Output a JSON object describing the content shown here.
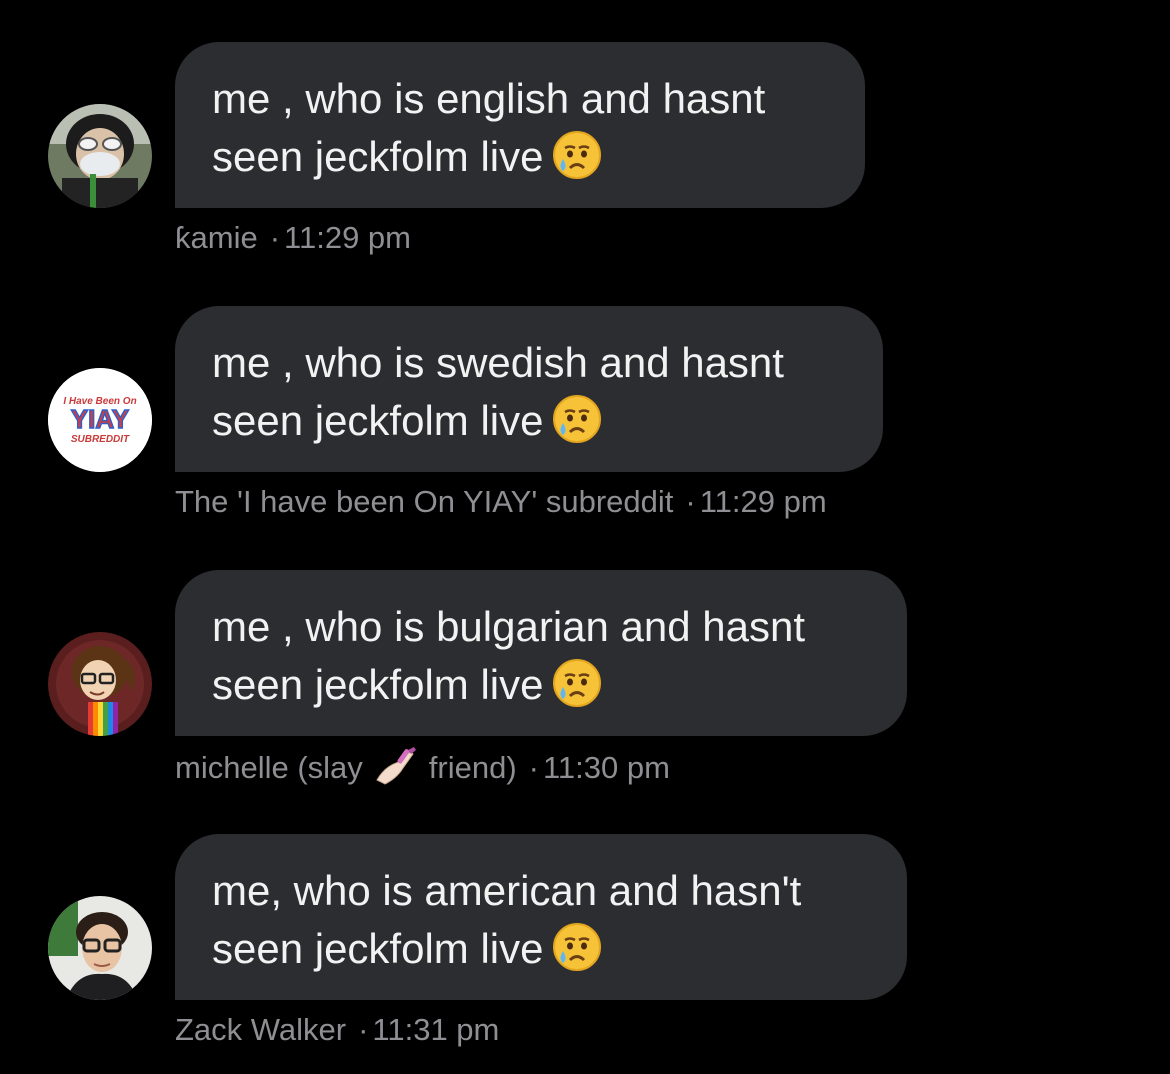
{
  "messages": [
    {
      "line1": "me , who is english and hasnt",
      "line2": "seen jeckfolm live",
      "sender": "ƙamie",
      "time": "11:29 pm",
      "emoji": "crying-face"
    },
    {
      "line1": "me , who is swedish and hasnt",
      "line2": "seen jeckfolm live",
      "sender": "The 'I have been On YIAY' subreddit",
      "time": "11:29 pm",
      "emoji": "crying-face",
      "avatar_badge": {
        "top": "I Have Been On",
        "main": "YIAY",
        "bottom": "SUBREDDIT"
      }
    },
    {
      "line1": "me , who is bulgarian and hasnt",
      "line2": "seen jeckfolm live",
      "sender_prefix": "michelle (slay",
      "sender_suffix": "friend)",
      "sender_emoji": "nail-polish",
      "time": "11:30 pm",
      "emoji": "crying-face"
    },
    {
      "line1": "me, who is american and hasn't",
      "line2": "seen jeckfolm live",
      "sender": "Zack Walker",
      "time": "11:31 pm",
      "emoji": "crying-face"
    }
  ],
  "separator": "·",
  "colors": {
    "background": "#000000",
    "bubble": "#2c2d30",
    "message_text": "#f2f2f2",
    "meta_text": "#8e8e93"
  }
}
